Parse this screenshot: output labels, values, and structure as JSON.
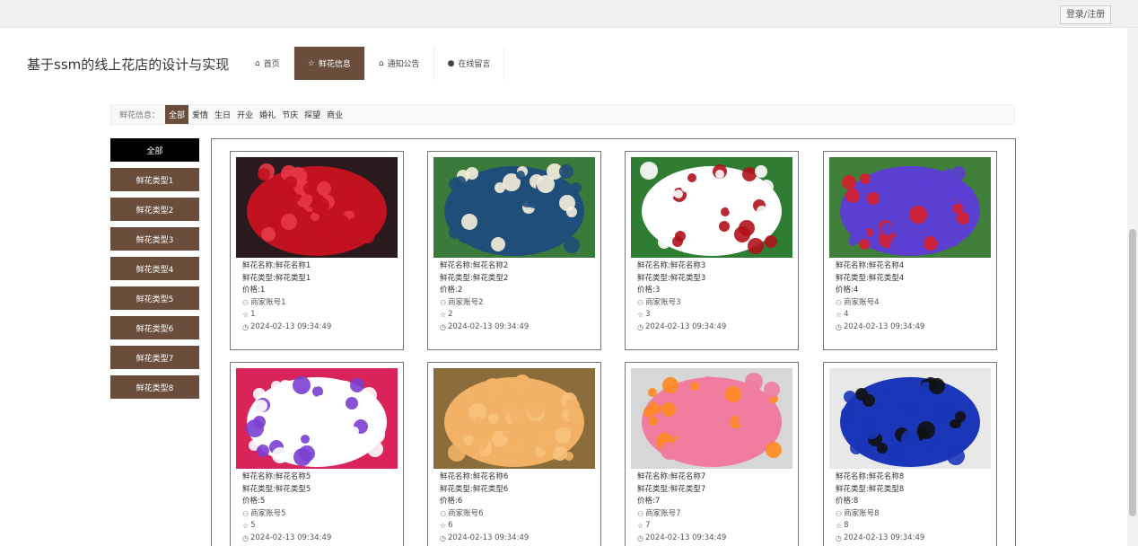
{
  "header": {
    "login_label": "登录/注册"
  },
  "site": {
    "title": "基于ssm的线上花店的设计与实现"
  },
  "nav": [
    {
      "label": "首页",
      "icon": "home-icon",
      "glyph": "⌂",
      "active": false
    },
    {
      "label": "鲜花信息",
      "icon": "star-icon",
      "glyph": "☆",
      "active": true
    },
    {
      "label": "通知公告",
      "icon": "bag-icon",
      "glyph": "⌂",
      "active": false
    },
    {
      "label": "在线留言",
      "icon": "info-circle-icon",
      "glyph": "●",
      "active": false
    }
  ],
  "filter": {
    "label": "鲜花信息：",
    "tags": [
      "全部",
      "爱情",
      "生日",
      "开业",
      "婚礼",
      "节庆",
      "探望",
      "商业"
    ]
  },
  "sidebar": {
    "items": [
      "全部",
      "鲜花类型1",
      "鲜花类型2",
      "鲜花类型3",
      "鲜花类型4",
      "鲜花类型5",
      "鲜花类型6",
      "鲜花类型7",
      "鲜花类型8"
    ]
  },
  "products": [
    {
      "name": "鲜花名称:鲜花名称1",
      "type": "鲜花类型:鲜花类型1",
      "price": "价格:1",
      "merchant": "商家账号1",
      "likes": "1",
      "time": "2024-02-13 09:34:49",
      "palette": [
        "#c1121f",
        "#e63946",
        "#2a1a1e"
      ]
    },
    {
      "name": "鲜花名称:鲜花名称2",
      "type": "鲜花类型:鲜花类型2",
      "price": "价格:2",
      "merchant": "商家账号2",
      "likes": "2",
      "time": "2024-02-13 09:34:49",
      "palette": [
        "#1f4e79",
        "#f5f0dc",
        "#3a7a3a"
      ]
    },
    {
      "name": "鲜花名称:鲜花名称3",
      "type": "鲜花类型:鲜花类型3",
      "price": "价格:3",
      "merchant": "商家账号3",
      "likes": "3",
      "time": "2024-02-13 09:34:49",
      "palette": [
        "#ffffff",
        "#b0121b",
        "#2f7d32"
      ]
    },
    {
      "name": "鲜花名称:鲜花名称4",
      "type": "鲜花类型:鲜花类型4",
      "price": "价格:4",
      "merchant": "商家账号4",
      "likes": "4",
      "time": "2024-02-13 09:34:49",
      "palette": [
        "#5b3fd1",
        "#d61f2b",
        "#3f7f3a"
      ]
    },
    {
      "name": "鲜花名称:鲜花名称5",
      "type": "鲜花类型:鲜花类型5",
      "price": "价格:5",
      "merchant": "商家账号5",
      "likes": "5",
      "time": "2024-02-13 09:34:49",
      "palette": [
        "#ffffff",
        "#7a3fd0",
        "#d9245a"
      ]
    },
    {
      "name": "鲜花名称:鲜花名称6",
      "type": "鲜花类型:鲜花类型6",
      "price": "价格:6",
      "merchant": "商家账号6",
      "likes": "6",
      "time": "2024-02-13 09:34:49",
      "palette": [
        "#f2b266",
        "#f7c27c",
        "#8a6d3b"
      ]
    },
    {
      "name": "鲜花名称:鲜花名称7",
      "type": "鲜花类型:鲜花类型7",
      "price": "价格:7",
      "merchant": "商家账号7",
      "likes": "7",
      "time": "2024-02-13 09:34:49",
      "palette": [
        "#f07ca0",
        "#ff8a1f",
        "#d7d7d7"
      ]
    },
    {
      "name": "鲜花名称:鲜花名称8",
      "type": "鲜花类型:鲜花类型8",
      "price": "价格:8",
      "merchant": "商家账号8",
      "likes": "8",
      "time": "2024-02-13 09:34:49",
      "palette": [
        "#1b36b8",
        "#111111",
        "#e8e8e8"
      ]
    }
  ]
}
